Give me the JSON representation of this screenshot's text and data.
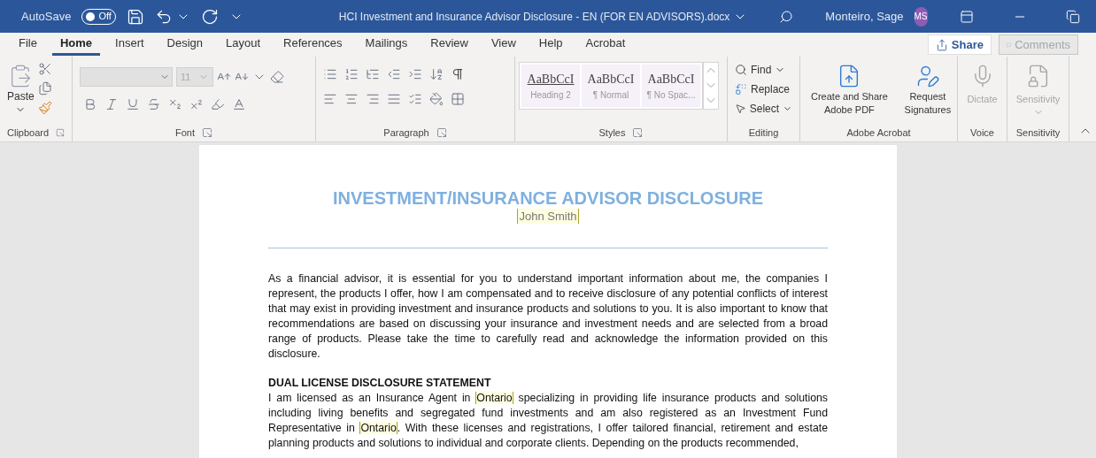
{
  "title_bar": {
    "autosave": {
      "label": "AutoSave",
      "on": false,
      "state_text": "Off"
    },
    "document_title": "HCI Investment and Insurance Advisor Disclosure - EN (FOR EN ADVISORS).docx",
    "user_name": "Monteiro, Sage",
    "avatar_initials": "MS"
  },
  "tabs": [
    {
      "label": "File",
      "selected": false
    },
    {
      "label": "Home",
      "selected": true
    },
    {
      "label": "Insert",
      "selected": false
    },
    {
      "label": "Design",
      "selected": false
    },
    {
      "label": "Layout",
      "selected": false
    },
    {
      "label": "References",
      "selected": false
    },
    {
      "label": "Mailings",
      "selected": false
    },
    {
      "label": "Review",
      "selected": false
    },
    {
      "label": "View",
      "selected": false
    },
    {
      "label": "Help",
      "selected": false
    },
    {
      "label": "Acrobat",
      "selected": false
    }
  ],
  "share_button": {
    "label": "Share"
  },
  "comments_button": {
    "label": "Comments",
    "disabled": true
  },
  "ribbon": {
    "clipboard": {
      "paste_label": "Paste",
      "group_label": "Clipboard"
    },
    "font": {
      "font_size": "11",
      "group_label": "Font"
    },
    "paragraph": {
      "group_label": "Paragraph"
    },
    "styles": {
      "group_label": "Styles",
      "items": [
        {
          "preview": "AaBbCcI",
          "name": "Heading 2",
          "kind": "heading"
        },
        {
          "preview": "AaBbCcI",
          "name": "¶ Normal",
          "kind": "body"
        },
        {
          "preview": "AaBbCcI",
          "name": "¶ No Spac...",
          "kind": "body"
        }
      ]
    },
    "editing": {
      "group_label": "Editing",
      "items": [
        {
          "label": "Find",
          "kind": "find"
        },
        {
          "label": "Replace",
          "kind": "replace"
        },
        {
          "label": "Select",
          "kind": "select"
        }
      ]
    },
    "acrobat": {
      "group_label": "Adobe Acrobat",
      "items": [
        {
          "label": "Create and Share Adobe PDF",
          "kind": "pdf"
        },
        {
          "label": "Request Signatures",
          "kind": "signature"
        }
      ]
    },
    "voice": {
      "group_label": "Voice",
      "button": "Dictate",
      "disabled": true
    },
    "sensitivity": {
      "group_label": "Sensitivity",
      "button": "Sensitivity",
      "disabled": true
    }
  },
  "document": {
    "heading": "INVESTMENT/INSURANCE ADVISOR DISCLOSURE",
    "name_field": "John Smith",
    "intro": "As a financial advisor, it is essential for you to understand important information about me, the companies I represent, the products I offer, how I am compensated and to receive disclosure of any potential conflicts of interest that may exist in providing investment and insurance products and solutions to you. It is also important to know that recommendations are based on discussing your insurance and investment needs and are selected from a broad range of products. Please take the time to carefully read and acknowledge the information provided on this disclosure.",
    "section_heading": "DUAL LICENSE DISCLOSURE STATEMENT",
    "section_body": [
      {
        "text": "I am licensed as an Insurance Agent in ",
        "kind": "text"
      },
      {
        "text": "Ontario",
        "kind": "field"
      },
      {
        "text": " specializing in providing life insurance products and solutions including living benefits and segregated fund investments and am also registered as an Investment Fund Representative in ",
        "kind": "text"
      },
      {
        "text": "Ontario",
        "kind": "field"
      },
      {
        "text": ". With these licenses and registrations, I offer tailored financial, retirement and estate planning products and solutions to individual and corporate clients. Depending on the products recommended,",
        "kind": "text"
      }
    ]
  }
}
